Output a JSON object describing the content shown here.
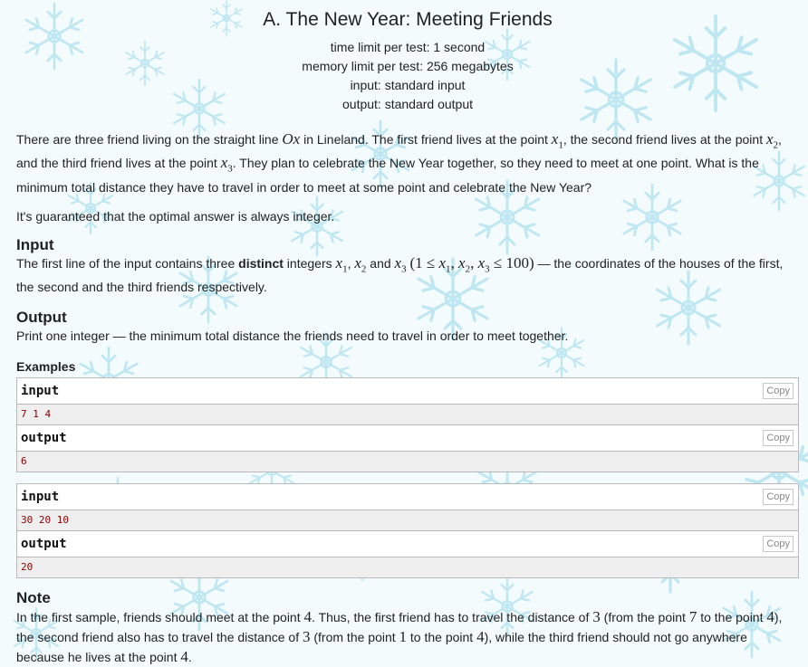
{
  "problem": {
    "title": "A. The New Year: Meeting Friends",
    "time_limit": "time limit per test: 1 second",
    "memory_limit": "memory limit per test: 256 megabytes",
    "input_file": "input: standard input",
    "output_file": "output: standard output"
  },
  "statement": {
    "p1_a": "There are three friend living on the straight line ",
    "p1_ox": "Ox",
    "p1_b": " in Lineland. The first friend lives at the point ",
    "p1_c": ", the second friend lives at the point ",
    "p1_d": ", and the third friend lives at the point ",
    "p1_e": ". They plan to celebrate the New Year together, so they need to meet at one point. What is the minimum total distance they have to travel in order to meet at some point and celebrate the New Year?",
    "p2": "It's guaranteed that the optimal answer is always integer."
  },
  "math": {
    "x": "x",
    "sub1": "1",
    "sub2": "2",
    "sub3": "3",
    "one": "1",
    "leq": "≤",
    "hundred": "100",
    "lparen": "(",
    "rparen": ")",
    "comma": ", "
  },
  "input_section": {
    "title": "Input",
    "a": "The first line of the input contains three ",
    "bold": "distinct",
    "b": " integers ",
    "and": " and ",
    "c": " — the coordinates of the houses of the first, the second and the third friends respectively."
  },
  "output_section": {
    "title": "Output",
    "text": "Print one integer — the minimum total distance the friends need to travel in order to meet together."
  },
  "examples": {
    "label": "Examples",
    "input_label": "input",
    "output_label": "output",
    "copy_label": "Copy",
    "items": [
      {
        "input": "7 1 4",
        "output": "6"
      },
      {
        "input": "30 20 10",
        "output": "20"
      }
    ]
  },
  "note": {
    "title": "Note",
    "a": "In the first sample, friends should meet at the point ",
    "n4": "4",
    "b": ". Thus, the first friend has to travel the distance of ",
    "n3": "3",
    "c": " (from the point ",
    "n7": "7",
    "d": " to the point ",
    "e": "), the second friend also has to travel the distance of ",
    "f": " (from the point ",
    "n1": "1",
    "g": " to the point ",
    "h": "), while the third friend should not go anywhere because he lives at the point ",
    "i": "."
  },
  "colors": {
    "background": "#f3fbfd",
    "snowflake": "#bfe7f2",
    "sample_bg": "#efefef",
    "sample_text": "#8b0000",
    "border": "#b9b9b9"
  }
}
